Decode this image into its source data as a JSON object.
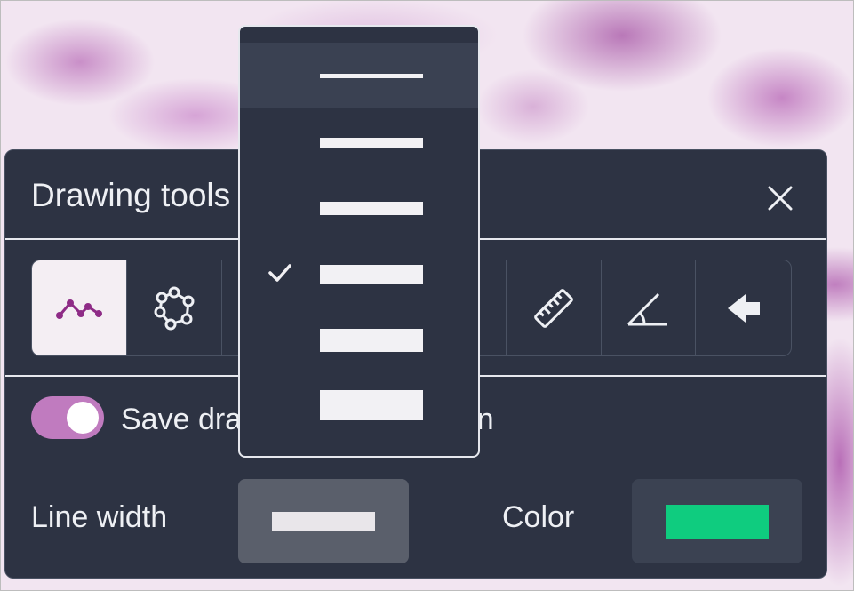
{
  "panel": {
    "title": "Drawing tools",
    "close_icon": "close-icon"
  },
  "tools": [
    {
      "name": "freehand-line-tool",
      "icon": "polyline-icon",
      "active": true
    },
    {
      "name": "polygon-tool",
      "icon": "polygon-icon",
      "active": false
    },
    {
      "name": "tool-3",
      "icon": "hidden",
      "active": false
    },
    {
      "name": "tool-4",
      "icon": "hidden",
      "active": false
    },
    {
      "name": "tool-5",
      "icon": "hidden",
      "active": false
    },
    {
      "name": "ruler-tool",
      "icon": "ruler-icon",
      "active": false
    },
    {
      "name": "angle-tool",
      "icon": "angle-icon",
      "active": false
    },
    {
      "name": "arrow-tool",
      "icon": "arrow-left-icon",
      "active": false
    }
  ],
  "save_toggle": {
    "label": "Save drawing as annotation",
    "visible_label_left": "Save dr",
    "visible_label_right": "annotation",
    "on": true
  },
  "line_width": {
    "label": "Line width",
    "options_count": 6,
    "selected_index": 3
  },
  "color": {
    "label": "Color",
    "value": "#0fcc7f"
  },
  "colors": {
    "panel_bg": "#2d3343",
    "accent": "#c07bbf",
    "active_tool_bg": "#f4eef3",
    "icon_purple": "#8e2b86"
  }
}
